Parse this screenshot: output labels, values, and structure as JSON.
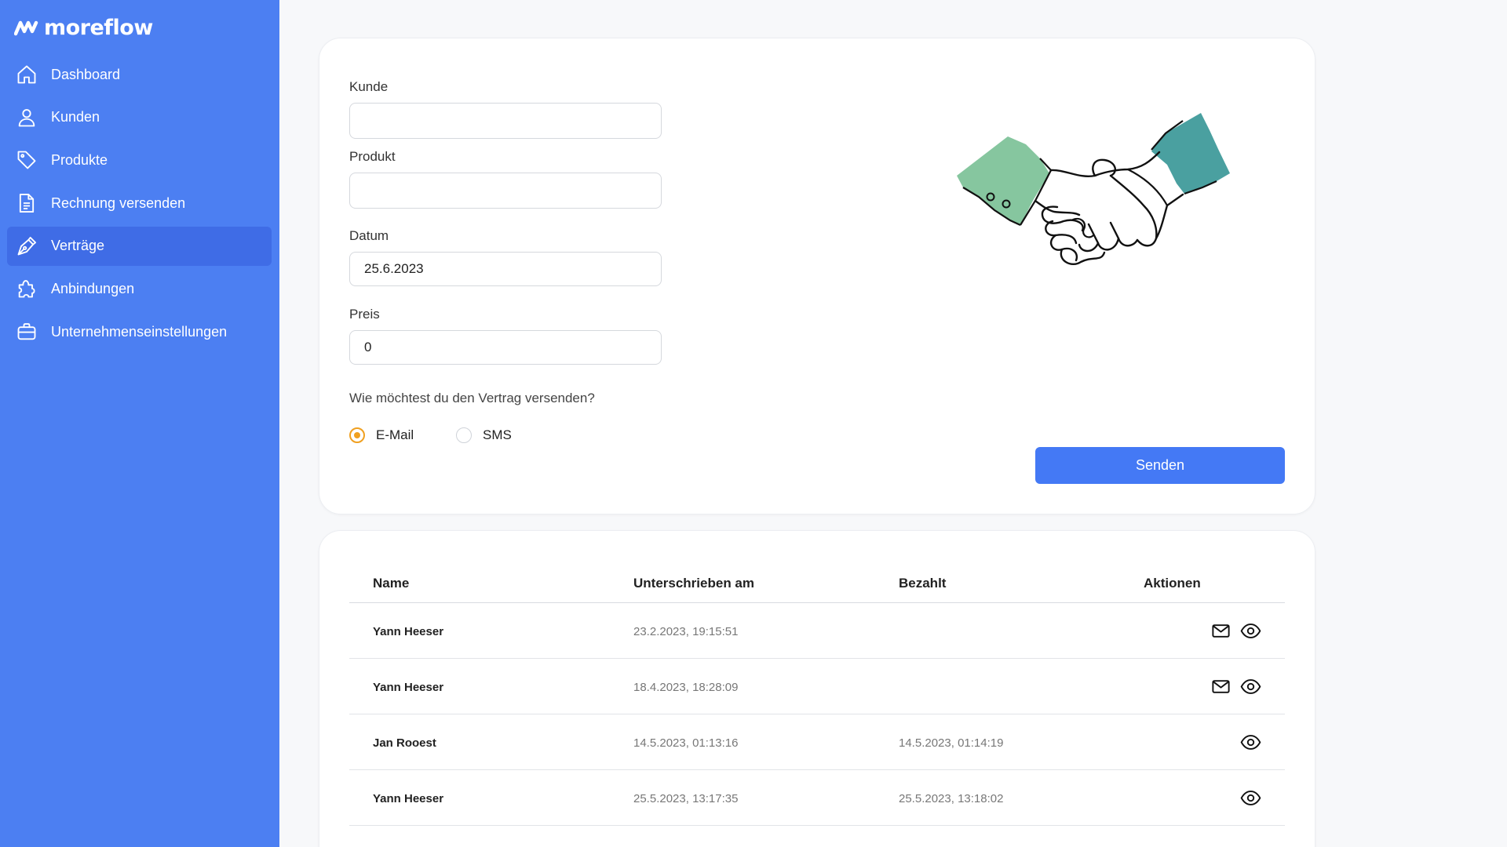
{
  "app": {
    "name": "moreflow"
  },
  "colors": {
    "sidebar": "#4c7ff2",
    "active": "#3f6ce6",
    "accent": "#4479f5",
    "radio": "#f0a020",
    "cuff_left": "#86c69f",
    "cuff_right": "#4aa0a0"
  },
  "sidebar": {
    "items": [
      {
        "label": "Dashboard",
        "icon": "home-icon"
      },
      {
        "label": "Kunden",
        "icon": "user-icon"
      },
      {
        "label": "Produkte",
        "icon": "tag-icon"
      },
      {
        "label": "Rechnung versenden",
        "icon": "document-icon"
      },
      {
        "label": "Verträge",
        "icon": "pen-icon",
        "active": true
      },
      {
        "label": "Anbindungen",
        "icon": "puzzle-icon"
      },
      {
        "label": "Unternehmenseinstellungen",
        "icon": "briefcase-icon"
      }
    ]
  },
  "form": {
    "customer_label": "Kunde",
    "customer_value": "",
    "product_label": "Produkt",
    "product_value": "",
    "date_label": "Datum",
    "date_value": "25.6.2023",
    "price_label": "Preis",
    "price_value": "0",
    "question": "Wie möchtest du den Vertrag versenden?",
    "option_email": "E-Mail",
    "option_sms": "SMS",
    "selected": "E-Mail",
    "submit_label": "Senden"
  },
  "table": {
    "headers": {
      "name": "Name",
      "signed": "Unterschrieben am",
      "paid": "Bezahlt",
      "actions": "Aktionen"
    },
    "rows": [
      {
        "name": "Yann Heeser",
        "signed": "23.2.2023, 19:15:51",
        "paid": "",
        "actions": [
          "mail-icon",
          "eye-icon"
        ]
      },
      {
        "name": "Yann Heeser",
        "signed": "18.4.2023, 18:28:09",
        "paid": "",
        "actions": [
          "mail-icon",
          "eye-icon"
        ]
      },
      {
        "name": "Jan Rooest",
        "signed": "14.5.2023, 01:13:16",
        "paid": "14.5.2023, 01:14:19",
        "actions": [
          "eye-icon"
        ]
      },
      {
        "name": "Yann Heeser",
        "signed": "25.5.2023, 13:17:35",
        "paid": "25.5.2023, 13:18:02",
        "actions": [
          "eye-icon"
        ]
      }
    ]
  }
}
